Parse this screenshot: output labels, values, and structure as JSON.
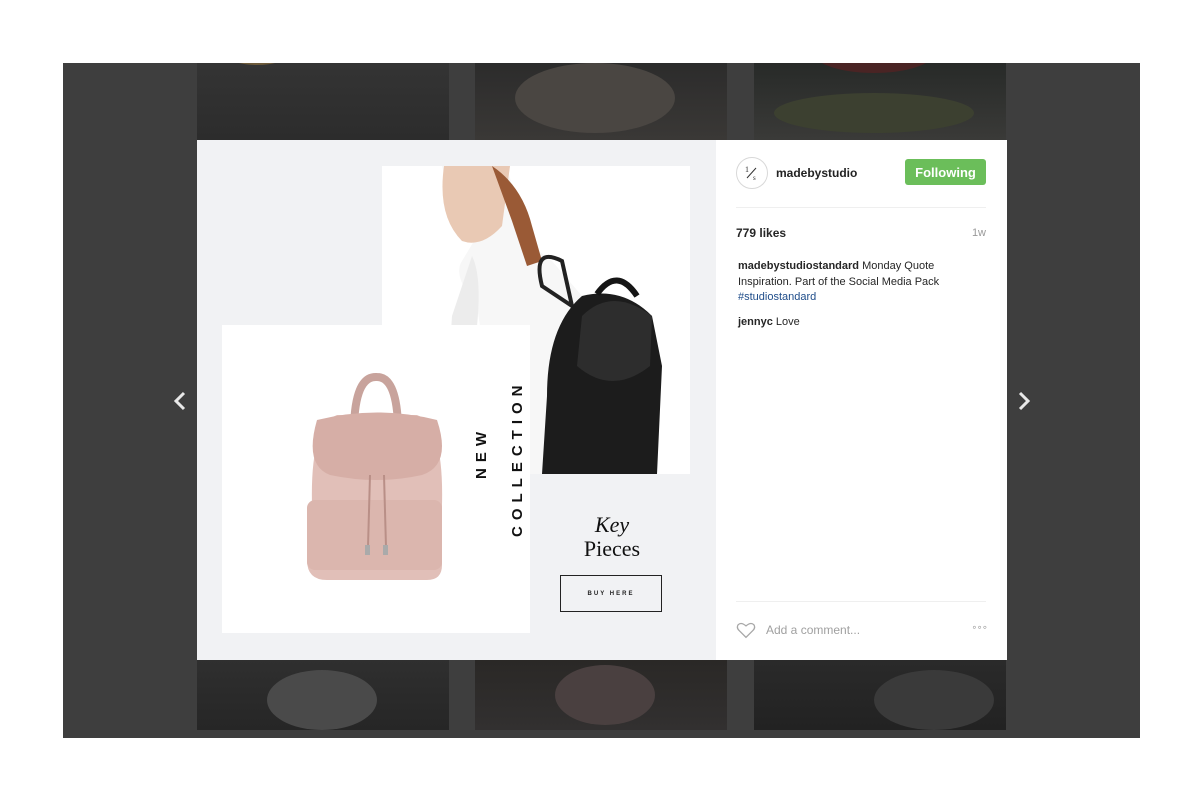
{
  "post": {
    "account": "madebystudio",
    "follow_label": "Following",
    "likes": "779 likes",
    "age": "1w",
    "caption_user": "madebystudiostandard",
    "caption_text": "Monday Quote Inspiration. Part of the Social Media Pack",
    "hashtag": "#studiostandard",
    "comment_user": "jennyc",
    "comment_text": "Love",
    "add_comment_placeholder": "Add a comment...",
    "more_label": "◦◦◦"
  },
  "artwork": {
    "vertical_1": "NEW",
    "vertical_2": "COLLECTION",
    "key_1": "Key",
    "key_2": "Pieces",
    "buy_label": "BUY HERE"
  },
  "colors": {
    "follow_button": "#6bbe5a",
    "hashtag": "#1f4d8a",
    "backdrop": "#3e3e3e"
  },
  "icons": {
    "prev": "chevron-left-icon",
    "next": "chevron-right-icon",
    "like": "heart-icon",
    "more": "more-options-icon"
  }
}
